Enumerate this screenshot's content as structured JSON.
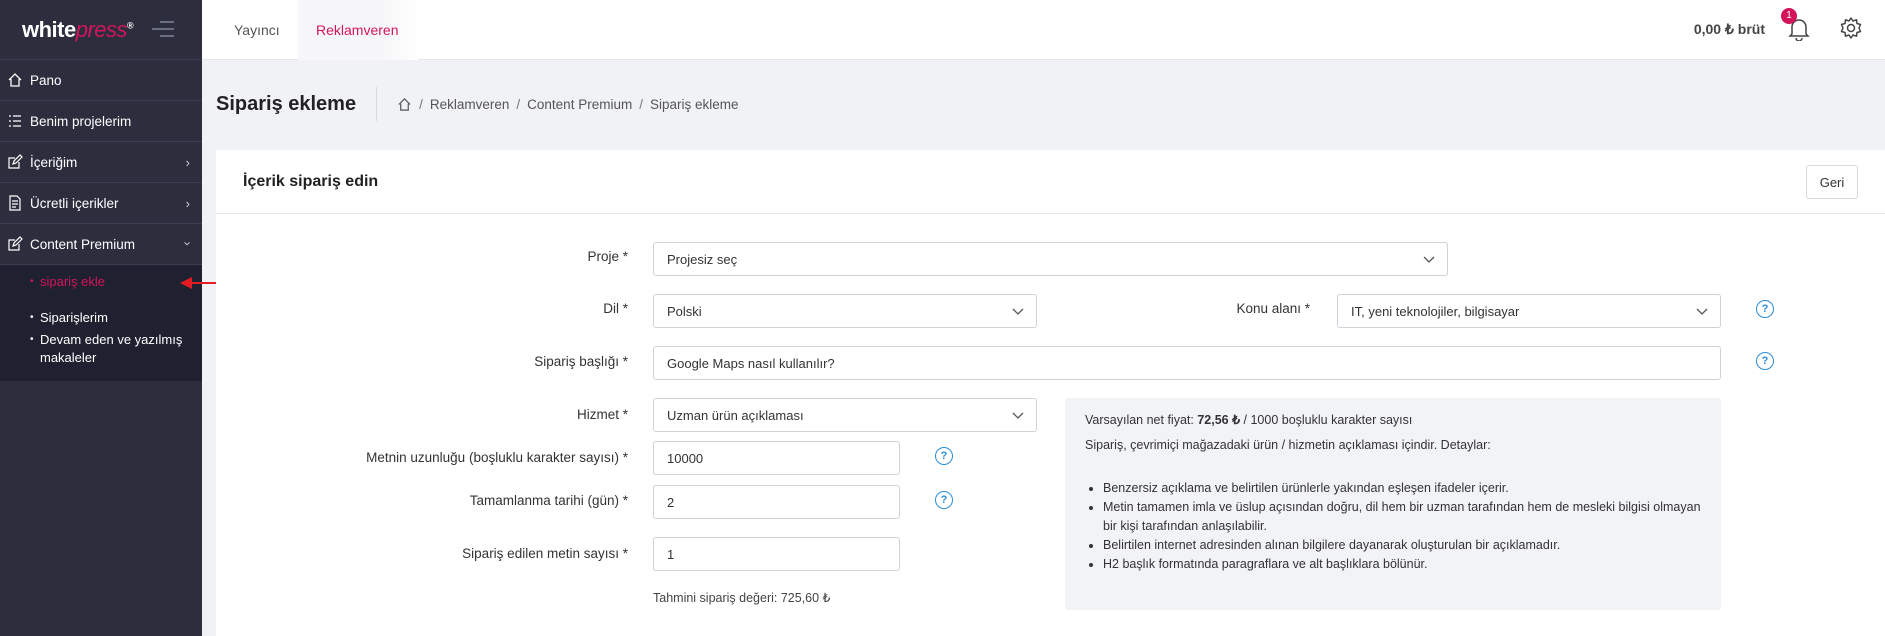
{
  "brand": {
    "logo_white": "white",
    "logo_accent": "press",
    "logo_mark": "®"
  },
  "sidebar": {
    "items": [
      {
        "label": "Pano",
        "icon": "home-icon"
      },
      {
        "label": "Benim projelerim",
        "icon": "list-icon"
      },
      {
        "label": "İçeriğim",
        "icon": "edit-icon"
      },
      {
        "label": "Ücretli içerikler",
        "icon": "document-icon"
      },
      {
        "label": "Content Premium",
        "icon": "edit-icon"
      }
    ],
    "submenu": [
      "sipariş ekle",
      "Siparişlerim",
      "Devam eden ve yazılmış makaleler"
    ]
  },
  "topbar": {
    "tabs": [
      "Yayıncı",
      "Reklamveren"
    ],
    "balance": "0,00 ₺ brüt",
    "notifications": "1"
  },
  "page": {
    "title": "Sipariş ekleme",
    "breadcrumb": [
      "Reklamveren",
      "Content Premium",
      "Sipariş ekleme"
    ]
  },
  "card": {
    "title": "İçerik sipariş edin",
    "back": "Geri"
  },
  "form": {
    "proje": {
      "label": "Proje *",
      "value": "Projesiz seç"
    },
    "dil": {
      "label": "Dil *",
      "value": "Polski"
    },
    "konu": {
      "label": "Konu alanı *",
      "value": "IT, yeni teknolojiler, bilgisayar"
    },
    "baslik": {
      "label": "Sipariş başlığı *",
      "value": "Google Maps nasıl kullanılır?"
    },
    "hizmet": {
      "label": "Hizmet *",
      "value": "Uzman ürün açıklaması"
    },
    "uzunluk": {
      "label": "Metnin uzunluğu (boşluklu karakter sayısı) *",
      "value": "10000"
    },
    "tarih": {
      "label": "Tamamlanma tarihi (gün) *",
      "value": "2"
    },
    "sayi": {
      "label": "Sipariş edilen metin sayısı *",
      "value": "1"
    },
    "estimate": "Tahmini sipariş değeri: 725,60 ₺"
  },
  "info": {
    "price_prefix": "Varsayılan net fiyat: ",
    "price_value": "72,56 ₺",
    "price_suffix": " / 1000 boşluklu karakter sayısı",
    "desc": "Sipariş, çevrimiçi mağazadaki ürün / hizmetin açıklaması içindir. Detaylar:",
    "bullets": [
      "Benzersiz açıklama ve belirtilen ürünlerle yakından eşleşen ifadeler içerir.",
      "Metin tamamen imla ve üslup açısından doğru, dil hem bir uzman tarafından hem de mesleki bilgisi olmayan bir kişi tarafından anlaşılabilir.",
      "Belirtilen internet adresinden alınan bilgilere dayanarak oluşturulan bir açıklamadır.",
      "H2 başlık formatında paragraflara ve alt başlıklara bölünür."
    ]
  },
  "colors": {
    "accent": "#d4145a",
    "sidebar": "#2c2e3e",
    "help": "#2b8dd8"
  }
}
